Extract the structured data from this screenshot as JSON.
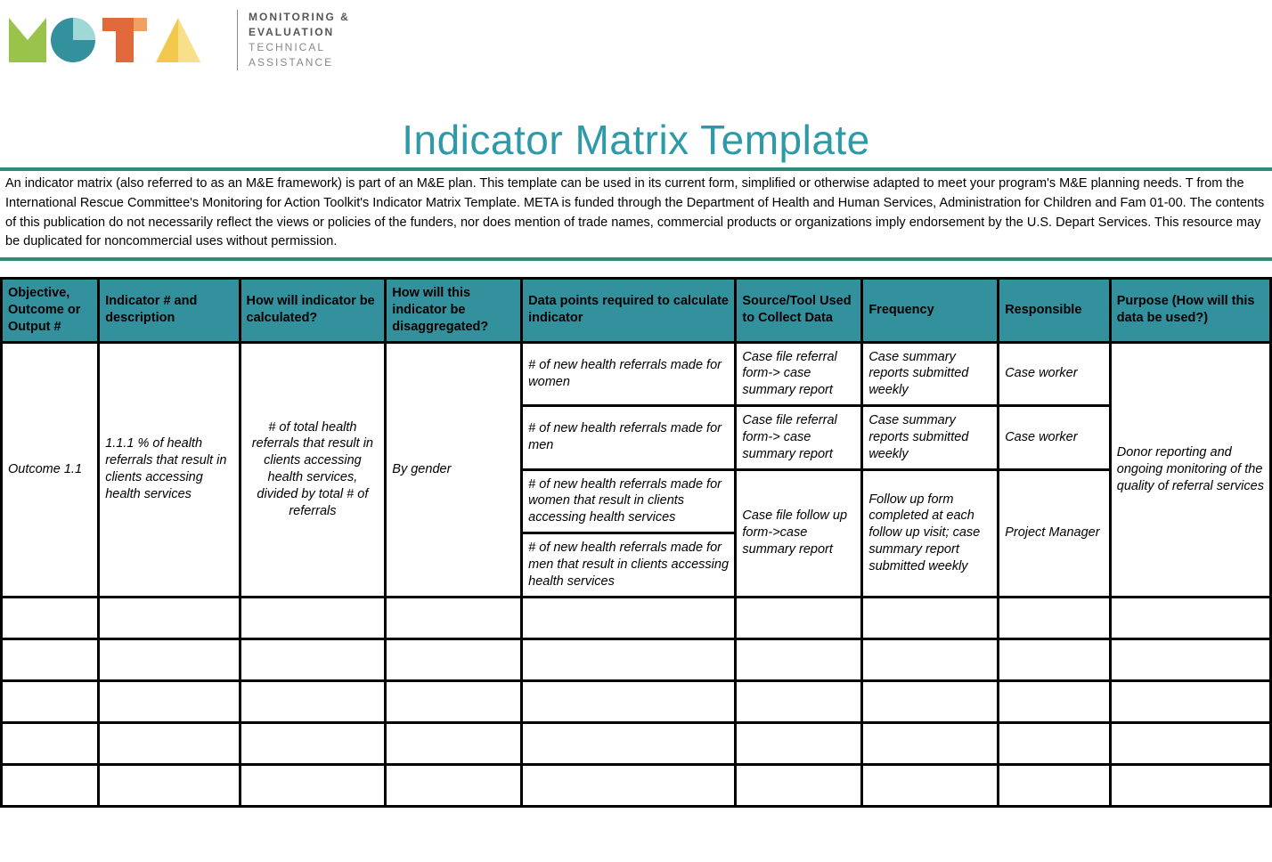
{
  "logo": {
    "line1": "MONITORING &",
    "line2": "EVALUATION",
    "line3": "TECHNICAL",
    "line4": "ASSISTANCE"
  },
  "title": "Indicator Matrix Template",
  "intro": "An indicator matrix (also referred to as an M&E framework) is part of an M&E plan.  This template can be used in its current form, simplified or otherwise adapted to meet your program's M&E planning needs.   T from the International Rescue Committee's Monitoring for Action Toolkit's Indicator Matrix Template. META is funded through the Department of Health and Human Services, Administration for Children and Fam 01-00. The contents of this publication do not necessarily reflect the views or policies of the funders, nor does mention of trade names, commercial products or organizations imply endorsement by the U.S. Depart Services. This resource may be duplicated for noncommercial uses without permission.",
  "headers": [
    "Objective, Outcome or Output #",
    "Indicator # and description",
    "How will indicator be calculated?",
    "How will this indicator be disaggregated?",
    "Data points required to calculate indicator",
    "Source/Tool Used to Collect Data",
    "Frequency",
    "Responsible",
    "Purpose (How will this data be used?)"
  ],
  "rows": {
    "objective": "Outcome 1.1",
    "indicator": "1.1.1 % of health referrals that result in clients accessing health services",
    "calculation": "# of total health referrals that result in clients accessing health services, divided by total # of referrals",
    "disaggregation": "By gender",
    "purpose": "Donor reporting and ongoing monitoring of the quality of referral services",
    "sub": [
      {
        "datapoint": "# of new health referrals made for women",
        "source": "Case file referral form-> case summary report",
        "frequency": "Case summary reports submitted weekly",
        "responsible": "Case worker"
      },
      {
        "datapoint": "# of new health referrals made for men",
        "source": "Case file referral form-> case summary report",
        "frequency": "Case summary reports submitted weekly",
        "responsible": "Case worker"
      },
      {
        "datapoint": "# of new health referrals made for women that result in clients accessing health services",
        "source": "Case file follow up form->case summary report",
        "frequency": "Follow up form completed at each follow up visit; case summary report submitted weekly",
        "responsible": "Project Manager"
      },
      {
        "datapoint": "# of new health referrals made for men that result in clients accessing health services"
      }
    ]
  }
}
